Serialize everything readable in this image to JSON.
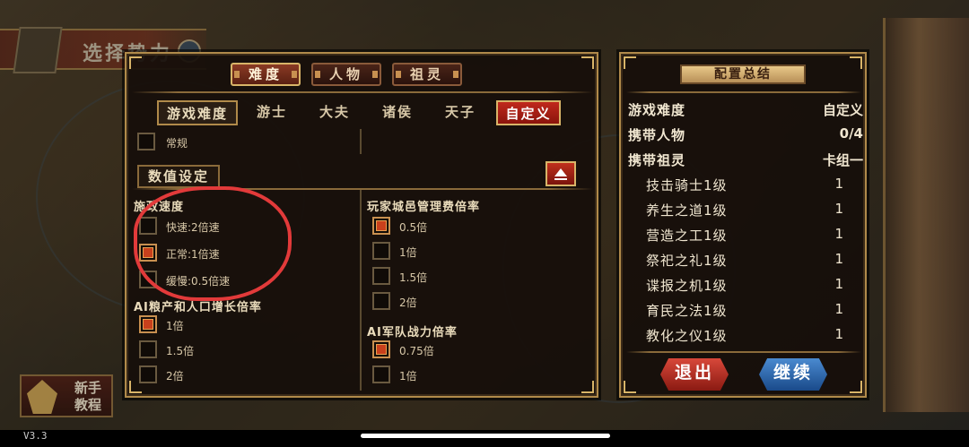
{
  "header": {
    "banner_title": "选择势力"
  },
  "tabs": [
    {
      "label": "难度",
      "active": true
    },
    {
      "label": "人物",
      "active": false
    },
    {
      "label": "祖灵",
      "active": false
    }
  ],
  "difficulty": {
    "label": "游戏难度",
    "options": [
      "游士",
      "大夫",
      "诸侯",
      "天子",
      "自定义"
    ],
    "selected": "自定义",
    "normal_label": "常规",
    "normal_checked": false
  },
  "numeric_settings": {
    "title": "数值设定",
    "admin_speed": {
      "title": "施政速度",
      "options": [
        {
          "label": "快速:2倍速",
          "checked": false
        },
        {
          "label": "正常:1倍速",
          "checked": true
        },
        {
          "label": "缓慢:0.5倍速",
          "checked": false
        }
      ]
    },
    "ai_growth": {
      "title": "AI粮产和人口增长倍率",
      "options": [
        {
          "label": "1倍",
          "checked": true
        },
        {
          "label": "1.5倍",
          "checked": false
        },
        {
          "label": "2倍",
          "checked": false
        }
      ]
    },
    "city_fee": {
      "title": "玩家城邑管理费倍率",
      "options": [
        {
          "label": "0.5倍",
          "checked": true
        },
        {
          "label": "1倍",
          "checked": false
        },
        {
          "label": "1.5倍",
          "checked": false
        },
        {
          "label": "2倍",
          "checked": false
        }
      ]
    },
    "ai_army": {
      "title": "AI军队战力倍率",
      "options": [
        {
          "label": "0.75倍",
          "checked": true
        },
        {
          "label": "1倍",
          "checked": false
        }
      ]
    }
  },
  "summary": {
    "title": "配置总结",
    "rows": [
      {
        "key": "游戏难度",
        "value": "自定义"
      },
      {
        "key": "携带人物",
        "value": "0/4"
      },
      {
        "key": "携带祖灵",
        "value": "卡组一"
      }
    ],
    "sub_rows": [
      {
        "key": "技击骑士1级",
        "value": "1"
      },
      {
        "key": "养生之道1级",
        "value": "1"
      },
      {
        "key": "营造之工1级",
        "value": "1"
      },
      {
        "key": "祭祀之礼1级",
        "value": "1"
      },
      {
        "key": "谍报之机1级",
        "value": "1"
      },
      {
        "key": "育民之法1级",
        "value": "1"
      },
      {
        "key": "教化之仪1级",
        "value": "1"
      }
    ],
    "exit_label": "退出",
    "continue_label": "继续"
  },
  "tutorial": {
    "line1": "新手",
    "line2": "教程"
  },
  "version": "V3.3",
  "colors": {
    "accent_red": "#c0281c",
    "frame_gold": "#b08a4a",
    "continue_blue": "#4a8ad0",
    "annotation_red": "#e23a3a"
  }
}
